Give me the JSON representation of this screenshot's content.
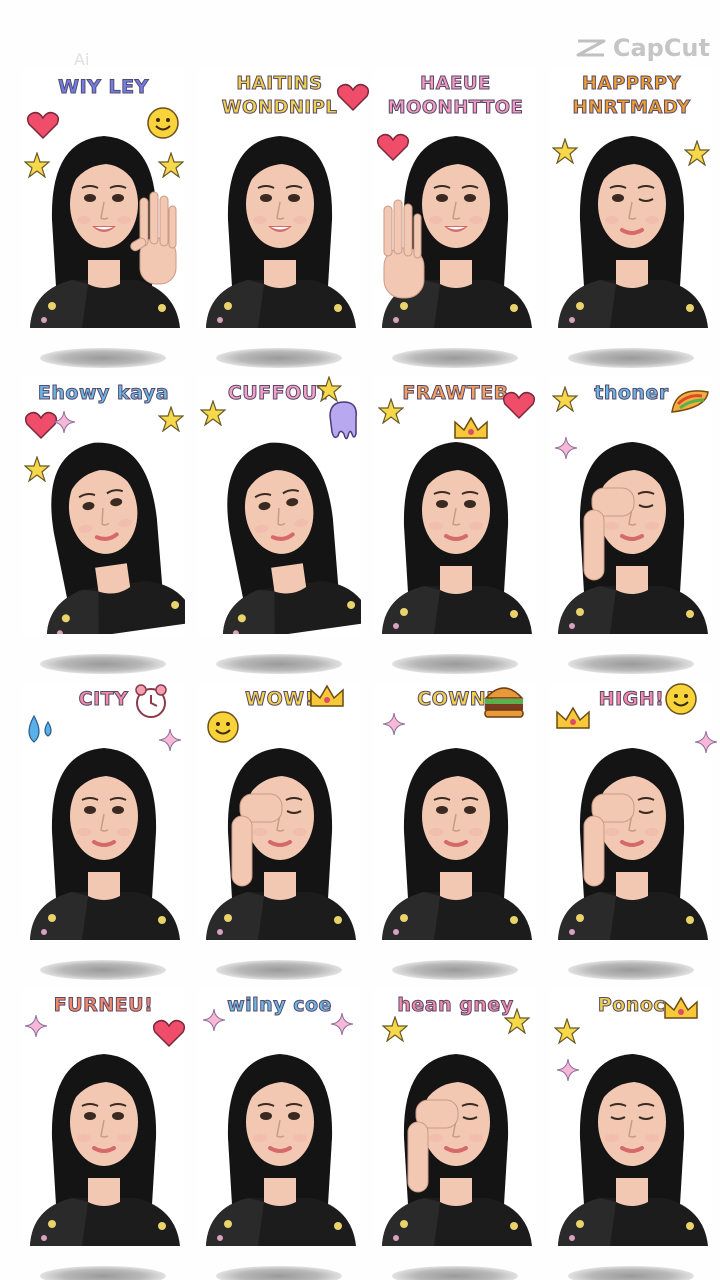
{
  "watermark": {
    "ai_label": "Ai",
    "brand": "CapCut"
  },
  "colors": {
    "hair": "#141414",
    "skin": "#f2c8b2",
    "lip": "#d66a6a",
    "shadow": "#a8a8a8"
  },
  "cells": [
    {
      "caption": "WIY LEY",
      "color": "#6d7fe6",
      "pose": "wave-right",
      "decor": [
        "heart-icon",
        "smiley-icon",
        "star-icon",
        "star-icon"
      ]
    },
    {
      "caption": "HAITINS WONDNIPL",
      "color": "#f0d24a",
      "pose": "smile",
      "decor": [
        "heart-icon"
      ]
    },
    {
      "caption": "HAEUE MOONHTTOE",
      "color": "#f09ac0",
      "pose": "wave-left",
      "decor": [
        "heart-icon"
      ]
    },
    {
      "caption": "HAPPRPY HNRTMADY",
      "color": "#f0a030",
      "pose": "wink",
      "decor": [
        "star-icon",
        "star-icon"
      ]
    },
    {
      "caption": "Ehowy kaya",
      "color": "#6ab8e6",
      "pose": "tilt",
      "decor": [
        "heart-icon",
        "sparkle-icon",
        "star-icon",
        "star-icon"
      ]
    },
    {
      "caption": "CUFFOUT",
      "color": "#f2a0c8",
      "pose": "tilt",
      "decor": [
        "star-icon",
        "star-icon",
        "blob-icon"
      ]
    },
    {
      "caption": "FRAWTEB",
      "color": "#f0a060",
      "pose": "neutral",
      "decor": [
        "star-icon",
        "crown-icon",
        "heart-icon"
      ]
    },
    {
      "caption": "thoner",
      "color": "#6ab8e6",
      "pose": "cover-eye",
      "decor": [
        "star-icon",
        "taco-icon",
        "sparkle-icon"
      ]
    },
    {
      "caption": "CITY",
      "color": "#f28aa8",
      "pose": "neutral",
      "decor": [
        "drop-icon",
        "clock-icon",
        "sparkle-icon"
      ]
    },
    {
      "caption": "WOW!",
      "color": "#f0d24a",
      "pose": "cover-eye",
      "decor": [
        "smiley-icon",
        "crown-icon"
      ]
    },
    {
      "caption": "COWNJ",
      "color": "#f0d24a",
      "pose": "neutral",
      "decor": [
        "sparkle-icon",
        "burger-icon"
      ]
    },
    {
      "caption": "HIGH!",
      "color": "#f28aa8",
      "pose": "cover-eye",
      "decor": [
        "crown-icon",
        "smiley-icon",
        "sparkle-icon"
      ]
    },
    {
      "caption": "FURNEU!",
      "color": "#f28a6a",
      "pose": "neutral",
      "decor": [
        "sparkle-icon",
        "heart-icon"
      ]
    },
    {
      "caption": "wilny coe",
      "color": "#6ab8e6",
      "pose": "neutral",
      "decor": [
        "sparkle-icon",
        "sparkle-icon"
      ]
    },
    {
      "caption": "hean gney",
      "color": "#f28aa8",
      "pose": "cover-eye",
      "decor": [
        "star-icon",
        "star-icon"
      ]
    },
    {
      "caption": "Ponoc",
      "color": "#f0d24a",
      "pose": "eyes-closed",
      "decor": [
        "star-icon",
        "crown-icon",
        "sparkle-icon"
      ]
    }
  ]
}
